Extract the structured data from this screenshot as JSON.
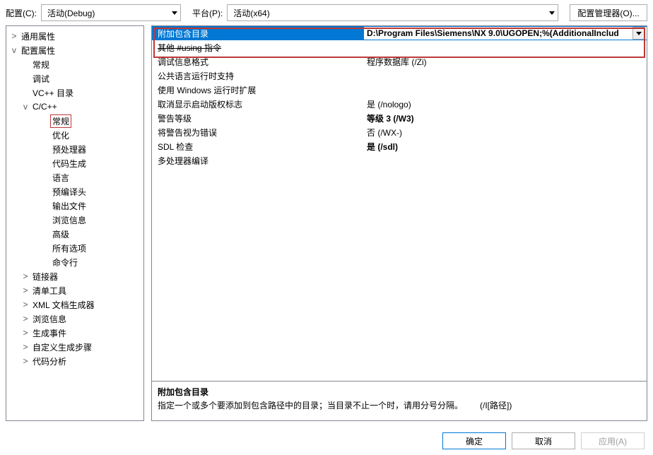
{
  "topbar": {
    "config_label": "配置(C):",
    "config_value": "活动(Debug)",
    "platform_label": "平台(P):",
    "platform_value": "活动(x64)",
    "config_manager_btn": "配置管理器(O)..."
  },
  "tree": {
    "items": [
      {
        "depth": 0,
        "toggle": ">",
        "label": "通用属性"
      },
      {
        "depth": 0,
        "toggle": "v",
        "label": "配置属性"
      },
      {
        "depth": 1,
        "toggle": "",
        "label": "常规"
      },
      {
        "depth": 1,
        "toggle": "",
        "label": "调试"
      },
      {
        "depth": 1,
        "toggle": "",
        "label": "VC++ 目录"
      },
      {
        "depth": 1,
        "toggle": "v",
        "label": "C/C++"
      },
      {
        "depth": 2,
        "toggle": "",
        "label": "常规",
        "selected": true
      },
      {
        "depth": 2,
        "toggle": "",
        "label": "优化"
      },
      {
        "depth": 2,
        "toggle": "",
        "label": "预处理器"
      },
      {
        "depth": 2,
        "toggle": "",
        "label": "代码生成"
      },
      {
        "depth": 2,
        "toggle": "",
        "label": "语言"
      },
      {
        "depth": 2,
        "toggle": "",
        "label": "预编译头"
      },
      {
        "depth": 2,
        "toggle": "",
        "label": "输出文件"
      },
      {
        "depth": 2,
        "toggle": "",
        "label": "浏览信息"
      },
      {
        "depth": 2,
        "toggle": "",
        "label": "高级"
      },
      {
        "depth": 2,
        "toggle": "",
        "label": "所有选项"
      },
      {
        "depth": 2,
        "toggle": "",
        "label": "命令行"
      },
      {
        "depth": 1,
        "toggle": ">",
        "label": "链接器"
      },
      {
        "depth": 1,
        "toggle": ">",
        "label": "清单工具"
      },
      {
        "depth": 1,
        "toggle": ">",
        "label": "XML 文档生成器"
      },
      {
        "depth": 1,
        "toggle": ">",
        "label": "浏览信息"
      },
      {
        "depth": 1,
        "toggle": ">",
        "label": "生成事件"
      },
      {
        "depth": 1,
        "toggle": ">",
        "label": "自定义生成步骤"
      },
      {
        "depth": 1,
        "toggle": ">",
        "label": "代码分析"
      }
    ]
  },
  "grid": {
    "rows": [
      {
        "name": "附加包含目录",
        "value": "D:\\Program Files\\Siemens\\NX 9.0\\UGOPEN;%(AdditionalInclud",
        "selected": true,
        "bold": true
      },
      {
        "name": "其他 #using 指令",
        "value": "",
        "struck": true
      },
      {
        "name": "调试信息格式",
        "value": "程序数据库 (/Zi)"
      },
      {
        "name": "公共语言运行时支持",
        "value": ""
      },
      {
        "name": "使用 Windows 运行时扩展",
        "value": ""
      },
      {
        "name": "取消显示启动版权标志",
        "value": "是 (/nologo)"
      },
      {
        "name": "警告等级",
        "value": "等级 3 (/W3)",
        "bold": true
      },
      {
        "name": "将警告视为错误",
        "value": "否 (/WX-)"
      },
      {
        "name": "SDL 检查",
        "value": "是 (/sdl)",
        "bold": true
      },
      {
        "name": "多处理器编译",
        "value": ""
      }
    ]
  },
  "description": {
    "title": "附加包含目录",
    "text": "指定一个或多个要添加到包含路径中的目录；当目录不止一个时，请用分号分隔。  (/I[路径])"
  },
  "buttons": {
    "ok": "确定",
    "cancel": "取消",
    "apply": "应用(A)"
  }
}
